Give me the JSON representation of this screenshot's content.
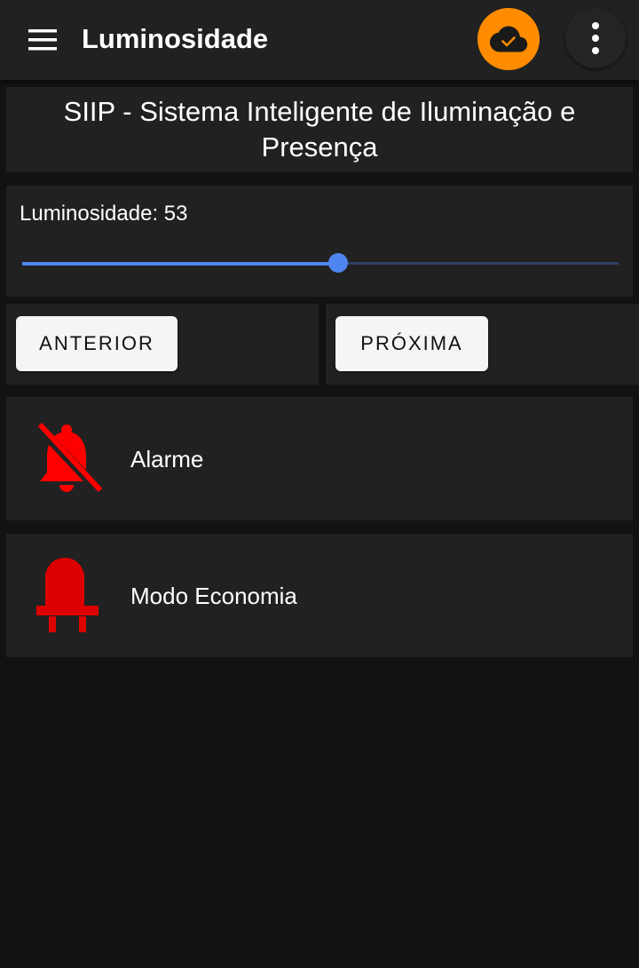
{
  "appbar": {
    "title": "Luminosidade",
    "menu_icon": "menu-icon",
    "cloud_icon": "cloud-check-icon",
    "more_icon": "more-vert-icon",
    "accent_color": "#ff8c00"
  },
  "header": {
    "text": "SIIP - Sistema Inteligente de Iluminação e Presença"
  },
  "slider": {
    "label": "Luminosidade: 53",
    "value": 53,
    "min": 0,
    "max": 100,
    "color": "#4f85ee"
  },
  "buttons": {
    "previous_label": "ANTERIOR",
    "next_label": "PRÓXIMA"
  },
  "rows": [
    {
      "label": "Alarme",
      "icon": "alarm-off-icon",
      "color": "#ff0000"
    },
    {
      "label": "Modo Economia",
      "icon": "led-icon",
      "color": "#dd0000"
    }
  ]
}
